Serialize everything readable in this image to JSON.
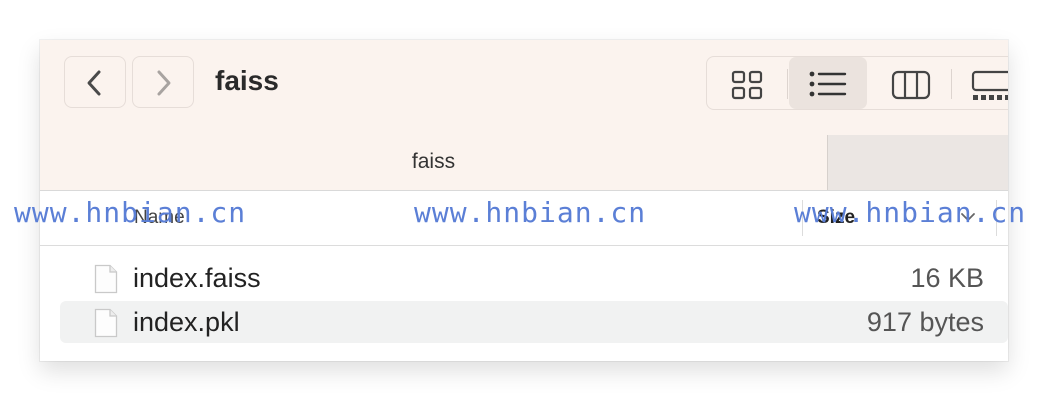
{
  "window": {
    "title": "faiss",
    "tab_label": "faiss"
  },
  "toolbar": {
    "back_icon": "chevron-left-icon",
    "forward_icon": "chevron-right-icon",
    "view_modes": [
      {
        "name": "icon-view",
        "icon": "grid-icon",
        "selected": false
      },
      {
        "name": "list-view",
        "icon": "list-icon",
        "selected": true
      },
      {
        "name": "column-view",
        "icon": "columns-icon",
        "selected": false
      },
      {
        "name": "gallery-view",
        "icon": "gallery-icon",
        "selected": false
      }
    ]
  },
  "columns": {
    "name_label": "Name",
    "size_label": "Size",
    "sort_icon": "chevron-down-icon"
  },
  "files": [
    {
      "name": "index.faiss",
      "size": "16 KB",
      "icon": "document-icon"
    },
    {
      "name": "index.pkl",
      "size": "917 bytes",
      "icon": "document-icon"
    }
  ],
  "watermark": [
    "www.hnbian.cn",
    "www.hnbian.cn",
    "www.hnbian.cn"
  ],
  "colors": {
    "toolbar_bg": "#fbf3ee",
    "selected_view_bg": "#ebe3de",
    "alt_row_bg": "#f1f2f2",
    "watermark": "#5b7fd6"
  }
}
